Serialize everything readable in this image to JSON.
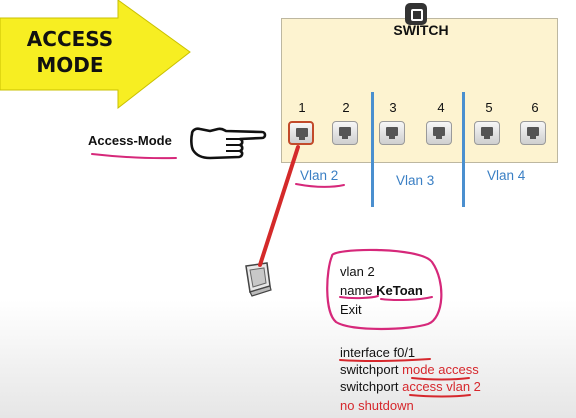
{
  "banner": {
    "line1": "ACCESS",
    "line2": "MODE"
  },
  "switch": {
    "title": "SWITCH",
    "ports": [
      "1",
      "2",
      "3",
      "4",
      "5",
      "6"
    ],
    "vlans": [
      "Vlan 2",
      "Vlan 3",
      "Vlan 4"
    ]
  },
  "access_mode_label": "Access-Mode",
  "vlan_config": {
    "line1": "vlan 2",
    "line2_prefix": "name ",
    "line2_name": "KeToan",
    "line3": "Exit"
  },
  "interface_config": {
    "line1": "interface f0/1",
    "line2_prefix": "switchport ",
    "line2_highlight": "mode access",
    "line3_prefix": "switchport ",
    "line3_highlight": "access vlan 2",
    "line4": "no shutdown"
  },
  "colors": {
    "arrow_fill": "#f7ee22",
    "switch_fill": "#fdf3d0",
    "vlan_blue": "#3a7fc4",
    "annotation": "#d6287a",
    "cable": "#d42a2a"
  }
}
